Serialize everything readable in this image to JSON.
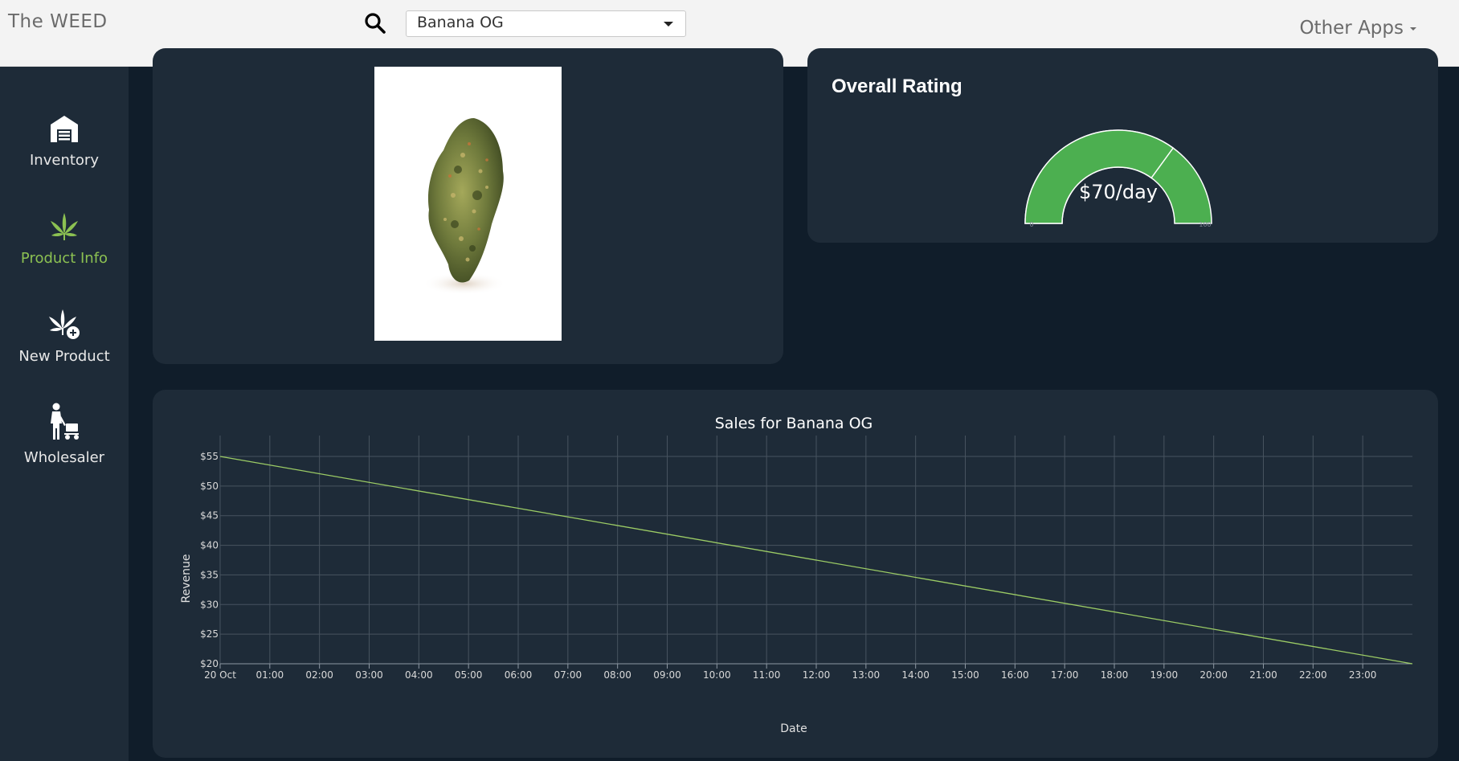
{
  "app": {
    "title": "The WEED"
  },
  "search": {
    "selected": "Banana OG"
  },
  "menu": {
    "other_apps": "Other Apps"
  },
  "sidebar": {
    "items": [
      {
        "label": "Inventory",
        "icon": "warehouse-icon",
        "active": false
      },
      {
        "label": "Product Info",
        "icon": "cannabis-leaf-icon",
        "active": true
      },
      {
        "label": "New Product",
        "icon": "add-leaf-icon",
        "active": false
      },
      {
        "label": "Wholesaler",
        "icon": "cart-person-icon",
        "active": false
      }
    ]
  },
  "rating": {
    "title": "Overall Rating",
    "value_label": "$70/day",
    "value": 70,
    "min_label": "0",
    "max_label": "100",
    "min": 0,
    "max": 100
  },
  "colors": {
    "accent_green": "#8cc152",
    "gauge_green": "#4caf50",
    "panel": "#1e2b38",
    "background": "#101d2a",
    "line": "#9ccc65"
  },
  "chart_data": {
    "type": "line",
    "title": "Sales for Banana OG",
    "xlabel": "Date",
    "ylabel": "Revenue",
    "x_ticks": [
      "20 Oct",
      "01:00",
      "02:00",
      "03:00",
      "04:00",
      "05:00",
      "06:00",
      "07:00",
      "08:00",
      "09:00",
      "10:00",
      "11:00",
      "12:00",
      "13:00",
      "14:00",
      "15:00",
      "16:00",
      "17:00",
      "18:00",
      "19:00",
      "20:00",
      "21:00",
      "22:00",
      "23:00"
    ],
    "y_ticks": [
      "$20",
      "$25",
      "$30",
      "$35",
      "$40",
      "$45",
      "$50",
      "$55"
    ],
    "ylim": [
      20,
      55
    ],
    "series": [
      {
        "x": [
          "20 Oct 00:00",
          "20 Oct 24:00"
        ],
        "y": [
          55,
          20
        ]
      }
    ],
    "grid": true
  }
}
